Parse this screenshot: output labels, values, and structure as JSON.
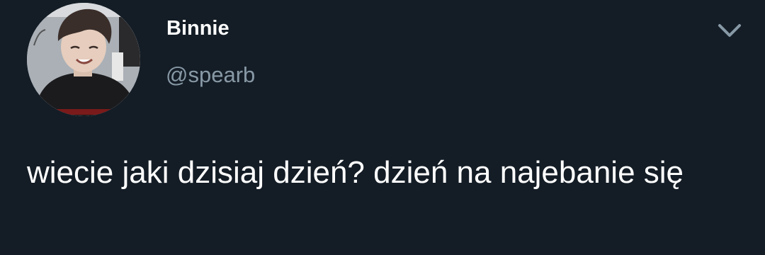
{
  "tweet": {
    "author": {
      "display_name": "Binnie",
      "handle": "@spearb"
    },
    "text": "wiecie jaki dzisiaj dzień? dzień na najebanie się",
    "menu_icon": "chevron-down-icon"
  },
  "colors": {
    "background": "#141d26",
    "primary_text": "#ffffff",
    "secondary_text": "#8899a6"
  }
}
